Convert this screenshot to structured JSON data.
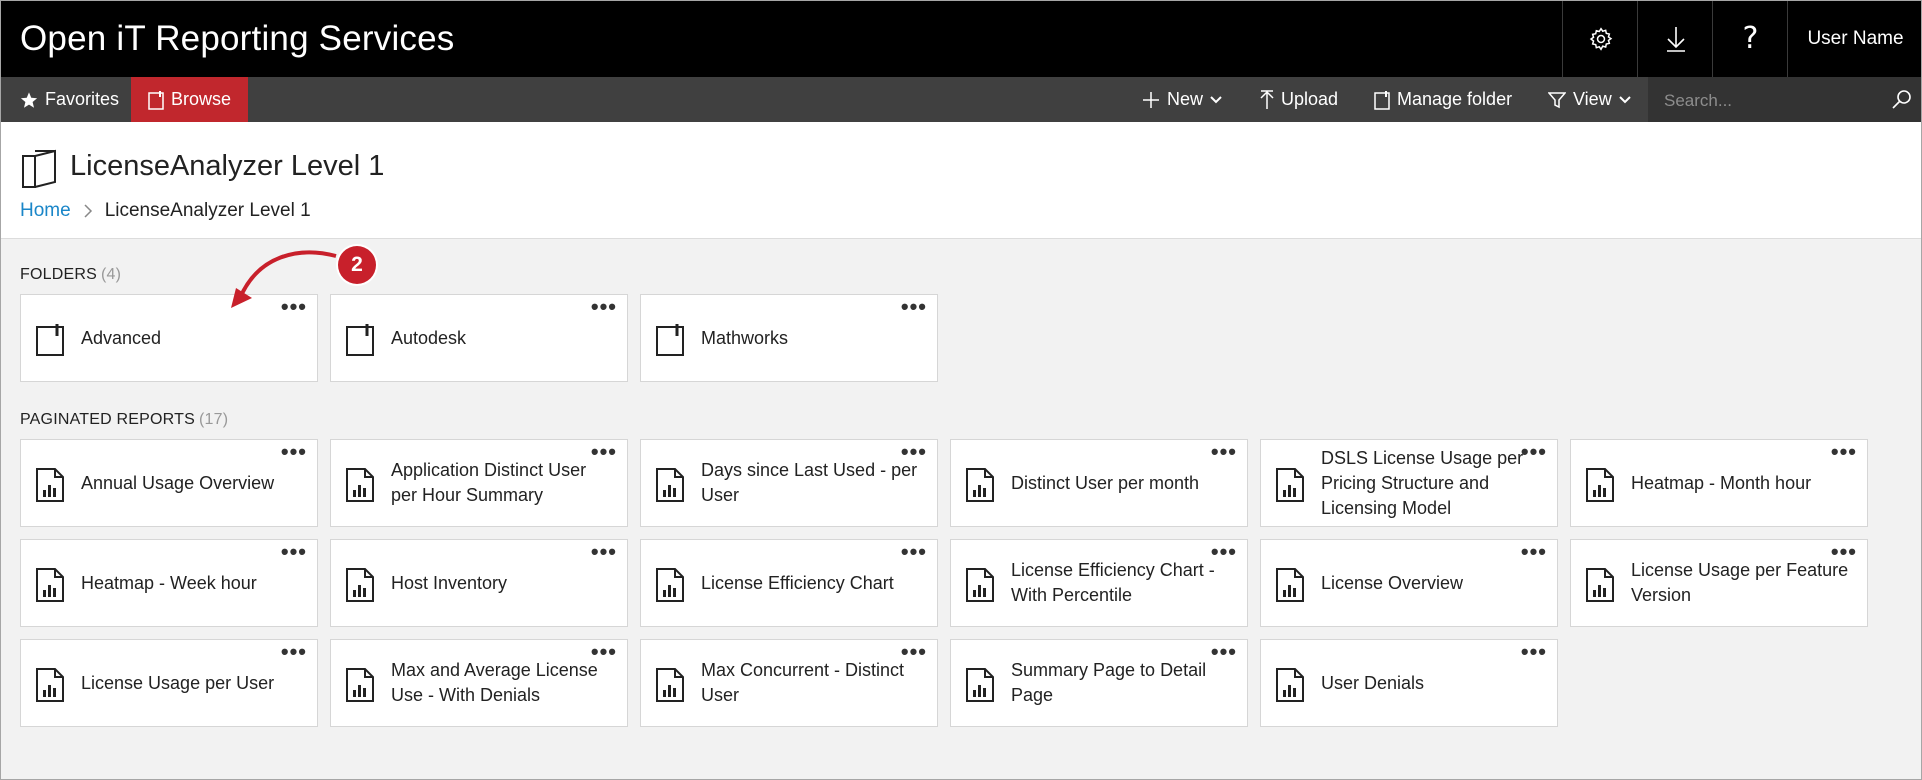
{
  "app": {
    "title": "Open iT Reporting Services",
    "user_name": "User Name",
    "help_label": "?"
  },
  "commandbar": {
    "favorites": "Favorites",
    "browse": "Browse",
    "new": "New",
    "upload": "Upload",
    "manage_folder": "Manage folder",
    "view": "View",
    "search_placeholder": "Search...",
    "accent_color": "#c1272d"
  },
  "page": {
    "title": "LicenseAnalyzer Level 1",
    "breadcrumb": {
      "home": "Home",
      "current": "LicenseAnalyzer Level 1"
    }
  },
  "folders": {
    "heading": "FOLDERS",
    "count": "(4)",
    "items": [
      {
        "label": "Advanced"
      },
      {
        "label": "Autodesk"
      },
      {
        "label": "Mathworks"
      }
    ]
  },
  "reports": {
    "heading": "PAGINATED REPORTS",
    "count": "(17)",
    "items": [
      {
        "label": "Annual Usage Overview"
      },
      {
        "label": "Application Distinct User per Hour Summary"
      },
      {
        "label": "Days since Last Used - per User"
      },
      {
        "label": "Distinct User per month"
      },
      {
        "label": "DSLS License Usage per Pricing Structure and Licensing Model"
      },
      {
        "label": "Heatmap - Month hour"
      },
      {
        "label": "Heatmap - Week hour"
      },
      {
        "label": "Host Inventory"
      },
      {
        "label": "License Efficiency Chart"
      },
      {
        "label": "License Efficiency Chart - With Percentile"
      },
      {
        "label": "License Overview"
      },
      {
        "label": "License Usage per Feature Version"
      },
      {
        "label": "License Usage per User"
      },
      {
        "label": "Max and Average License Use - With Denials"
      },
      {
        "label": "Max Concurrent - Distinct User"
      },
      {
        "label": "Summary Page to Detail Page"
      },
      {
        "label": "User Denials"
      }
    ]
  },
  "more_label": "•••",
  "annotation": {
    "number": "2",
    "color": "#c8202b"
  }
}
